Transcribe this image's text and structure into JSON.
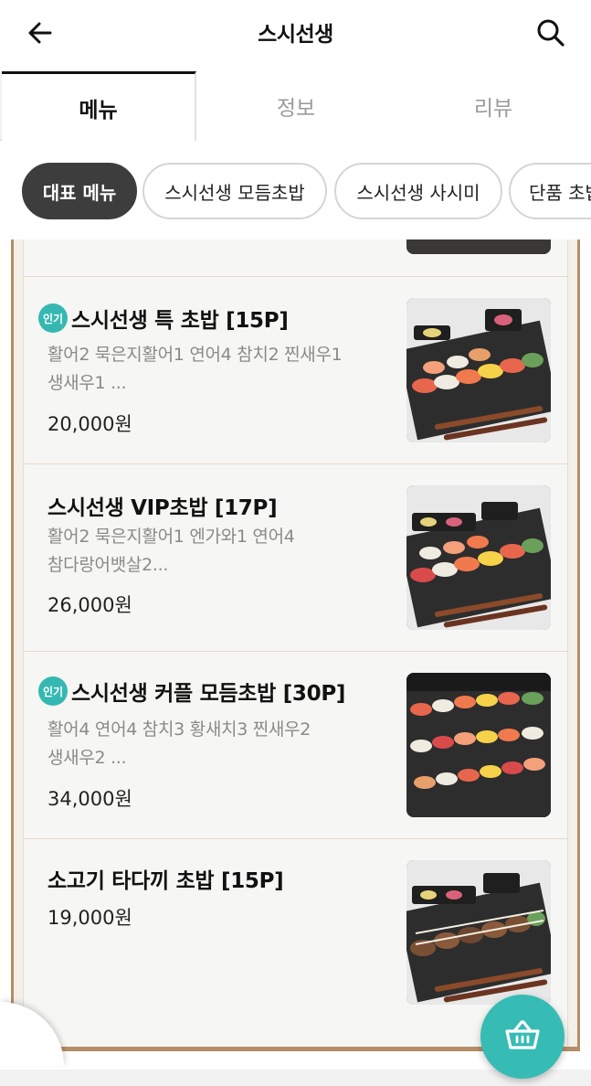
{
  "header": {
    "title": "스시선생",
    "back_icon": "arrow-left-icon",
    "search_icon": "search-icon"
  },
  "tabs": [
    {
      "label": "메뉴",
      "active": true
    },
    {
      "label": "정보",
      "active": false
    },
    {
      "label": "리뷰",
      "active": false
    }
  ],
  "categories": [
    {
      "label": "대표 메뉴",
      "active": true
    },
    {
      "label": "스시선생 모듬초밥",
      "active": false
    },
    {
      "label": "스시선생 사시미",
      "active": false
    },
    {
      "label": "단품 초밥",
      "active": false
    }
  ],
  "menu_items": [
    {
      "name": "스시선생 특 초밥 [15P]",
      "popular": true,
      "badge": "인기",
      "desc_line1": "활어2 묵은지활어1 연어4 참치2 찐새우1",
      "desc_line2": "생새우1 ...",
      "price": "20,000원"
    },
    {
      "name": "스시선생 VIP초밥 [17P]",
      "popular": false,
      "desc_line1": "활어2 묵은지활어1 엔가와1 연어4",
      "desc_line2": "참다랑어뱃살2...",
      "price": "26,000원"
    },
    {
      "name": "스시선생 커플 모듬초밥 [30P]",
      "popular": true,
      "badge": "인기",
      "desc_line1": "활어4 연어4 참치3 황새치3 찐새우2",
      "desc_line2": "생새우2 ...",
      "price": "34,000원"
    },
    {
      "name": "소고기 타다끼 초밥 [15P]",
      "popular": false,
      "price": "19,000원"
    }
  ],
  "cart_icon": "basket-icon",
  "colors": {
    "accent": "#36bcb4",
    "board_frame": "#b58e66",
    "chip_active": "#3d3d3d"
  }
}
